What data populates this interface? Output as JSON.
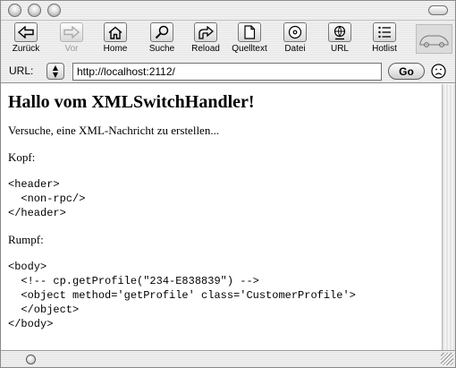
{
  "toolbar": {
    "back": "Zurück",
    "forward": "Vor",
    "home": "Home",
    "search": "Suche",
    "reload": "Reload",
    "source": "Quelltext",
    "file": "Datei",
    "url": "URL",
    "hotlist": "Hotlist"
  },
  "address": {
    "label": "URL:",
    "value": "http://localhost:2112/",
    "go": "Go"
  },
  "page": {
    "heading": "Hallo vom XMLSwitchHandler!",
    "intro": "Versuche, eine XML-Nachricht zu erstellen...",
    "header_label": "Kopf:",
    "header_code": "<header>\n  <non-rpc/>\n</header>",
    "body_label": "Rumpf:",
    "body_code": "<body>\n  <!-- cp.getProfile(\"234-E838839\") -->\n  <object method='getProfile' class='CustomerProfile'>\n  </object>\n</body>"
  },
  "icons": {
    "back": "left-arrow-icon",
    "forward": "right-arrow-icon",
    "home": "house-icon",
    "search": "magnifier-icon",
    "reload": "reload-icon",
    "source": "document-icon",
    "file": "disc-icon",
    "url": "globe-icon",
    "hotlist": "list-icon",
    "status": "frown-face-icon"
  },
  "colors": {
    "disabled_text": "#9a9a9a",
    "chrome": "#e6e6e6"
  }
}
